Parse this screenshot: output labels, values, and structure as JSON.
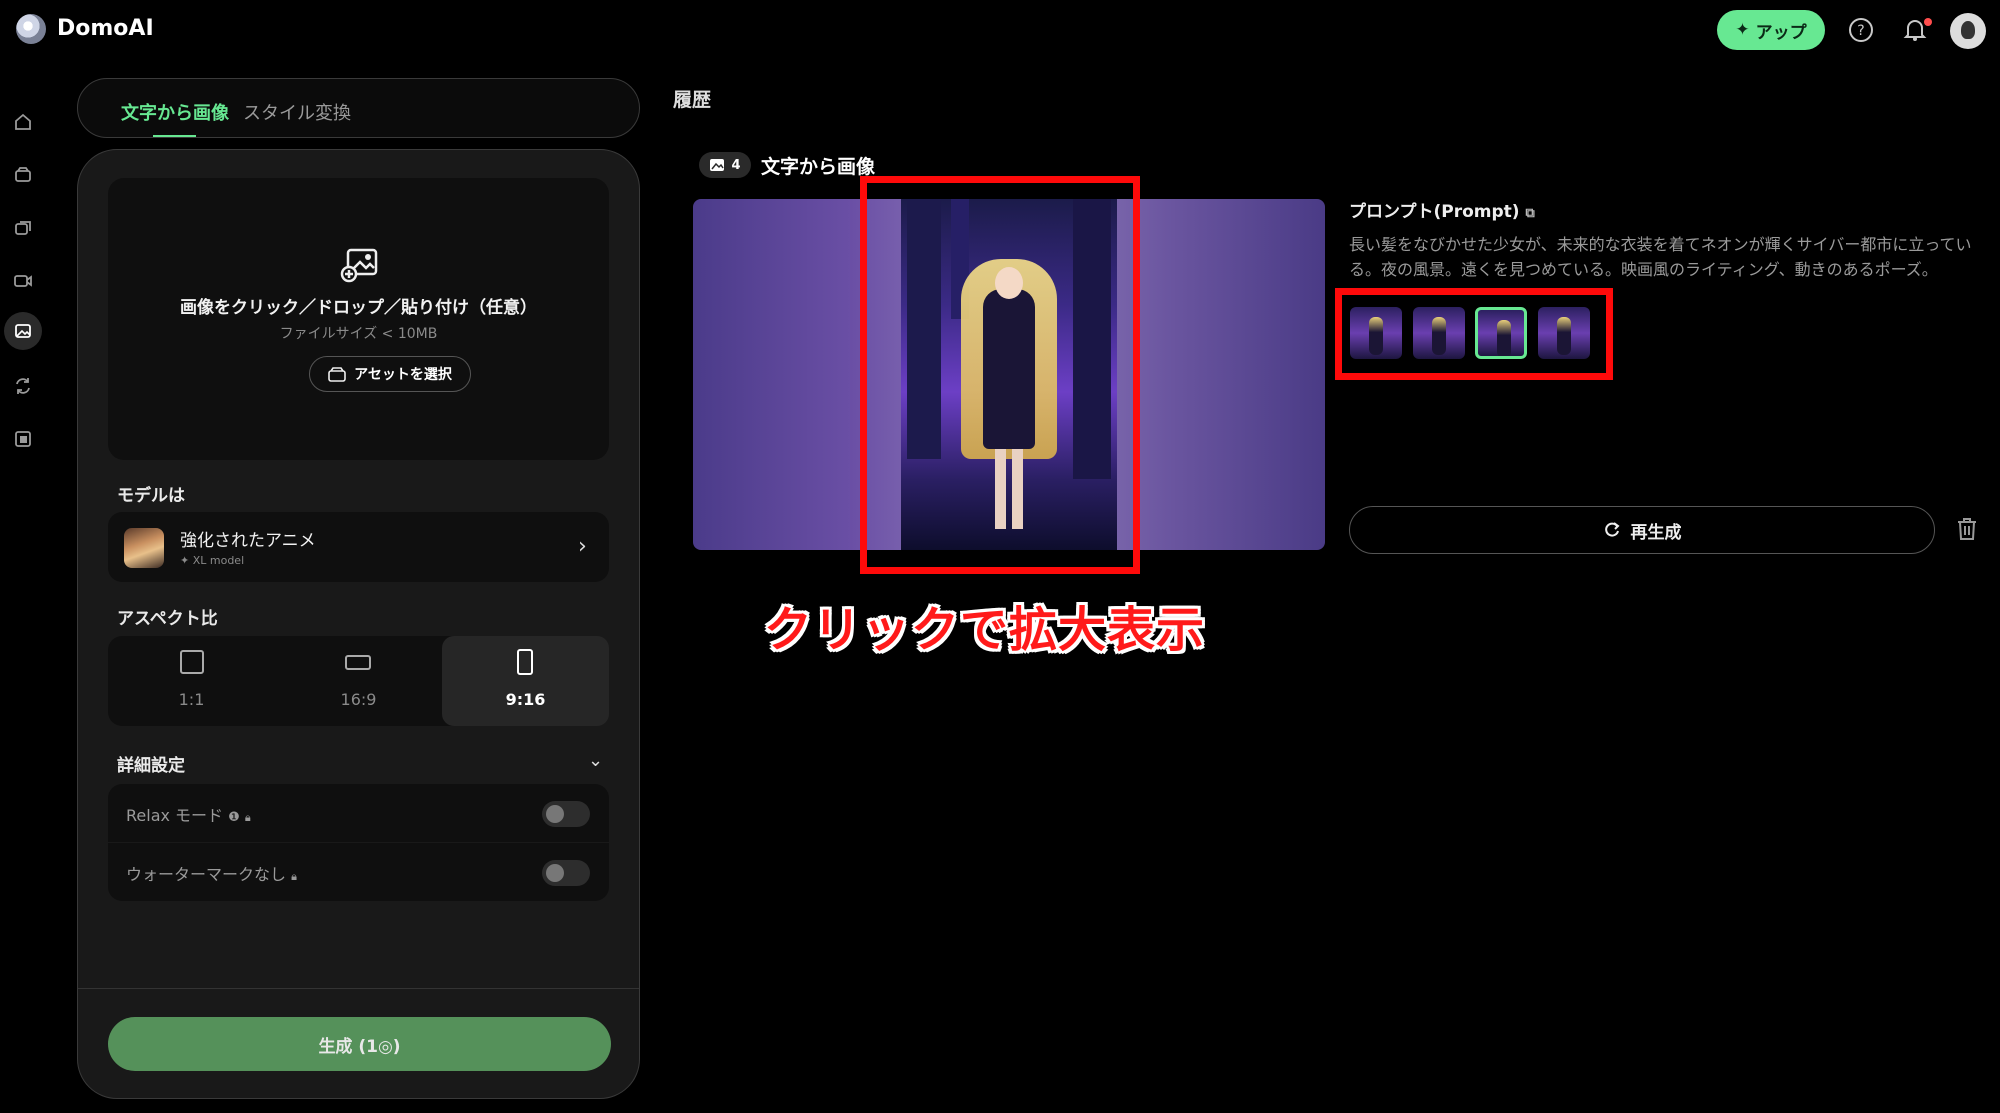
{
  "app": {
    "name": "DomoAI",
    "upgrade_label": "アップ"
  },
  "tabs": [
    {
      "label": "文字から画像",
      "active": true
    },
    {
      "label": "スタイル変換",
      "active": false
    }
  ],
  "upload": {
    "title": "画像をクリック／ドロップ／貼り付け（任意）",
    "subtitle": "ファイルサイズ < 10MB",
    "asset_button": "アセットを選択"
  },
  "model": {
    "section_label": "モデルは",
    "name": "強化されたアニメ",
    "tag": "XL model"
  },
  "aspect": {
    "section_label": "アスペクト比",
    "options": [
      "1:1",
      "16:9",
      "9:16"
    ],
    "selected": "9:16"
  },
  "advanced": {
    "section_label": "詳細設定",
    "relax_label": "Relax モード",
    "relax_on": false,
    "watermark_label": "ウォーターマークなし",
    "watermark_on": false
  },
  "generate_button": "生成 (1◎)",
  "history": {
    "title": "履歴",
    "count": "4",
    "type_label": "文字から画像",
    "prompt_title": "プロンプト(Prompt)",
    "prompt_text": "長い髪をなびかせた少女が、未来的な衣装を着てネオンが輝くサイバー都市に立っている。夜の風景。遠くを見つめている。映画風のライティング、動きのあるポーズ。",
    "regenerate_label": "再生成",
    "selected_thumbnail": 3
  },
  "annotation": {
    "text": "クリックで拡大表示",
    "color": "#ff1a1a"
  },
  "colors": {
    "accent": "#67e892",
    "generate": "#55915a",
    "highlight": "#ff0a0a"
  }
}
